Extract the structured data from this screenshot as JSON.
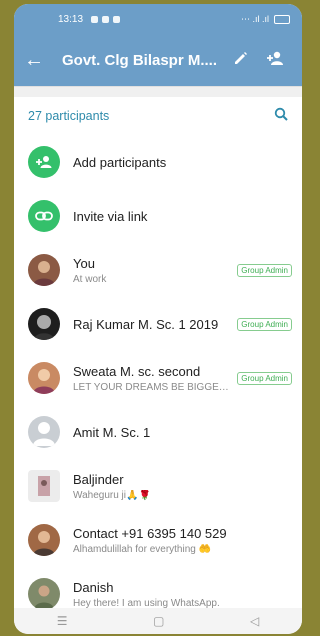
{
  "status_bar": {
    "time": "13:13",
    "right": "⋯ .ıl .ıl"
  },
  "header": {
    "title": "Govt. Clg Bilaspr M...."
  },
  "participants": {
    "count_label": "27 participants"
  },
  "actions": [
    {
      "label": "Add participants"
    },
    {
      "label": "Invite via link"
    }
  ],
  "members": [
    {
      "name": "You",
      "status": "At work",
      "badge": "Group Admin"
    },
    {
      "name": "Raj Kumar M. Sc. 1 2019",
      "status": "",
      "badge": "Group Admin"
    },
    {
      "name": "Sweata M. sc. second",
      "status": "LET YOUR DREAMS BE BIGGER THAN YOU...",
      "badge": "Group Admin"
    },
    {
      "name": "Amit M. Sc. 1",
      "status": "",
      "badge": ""
    },
    {
      "name": "Baljinder",
      "status": "Waheguru  ji🙏🌹",
      "badge": ""
    },
    {
      "name": "Contact +91 6395 140 529",
      "status": "Alhamdulillah for everything 🤲",
      "badge": ""
    },
    {
      "name": "Danish",
      "status": "Hey there! I am using WhatsApp.",
      "badge": ""
    }
  ],
  "colors": {
    "header": "#6c9ec8",
    "accent": "#2e8bab",
    "green": "#34c06b"
  }
}
